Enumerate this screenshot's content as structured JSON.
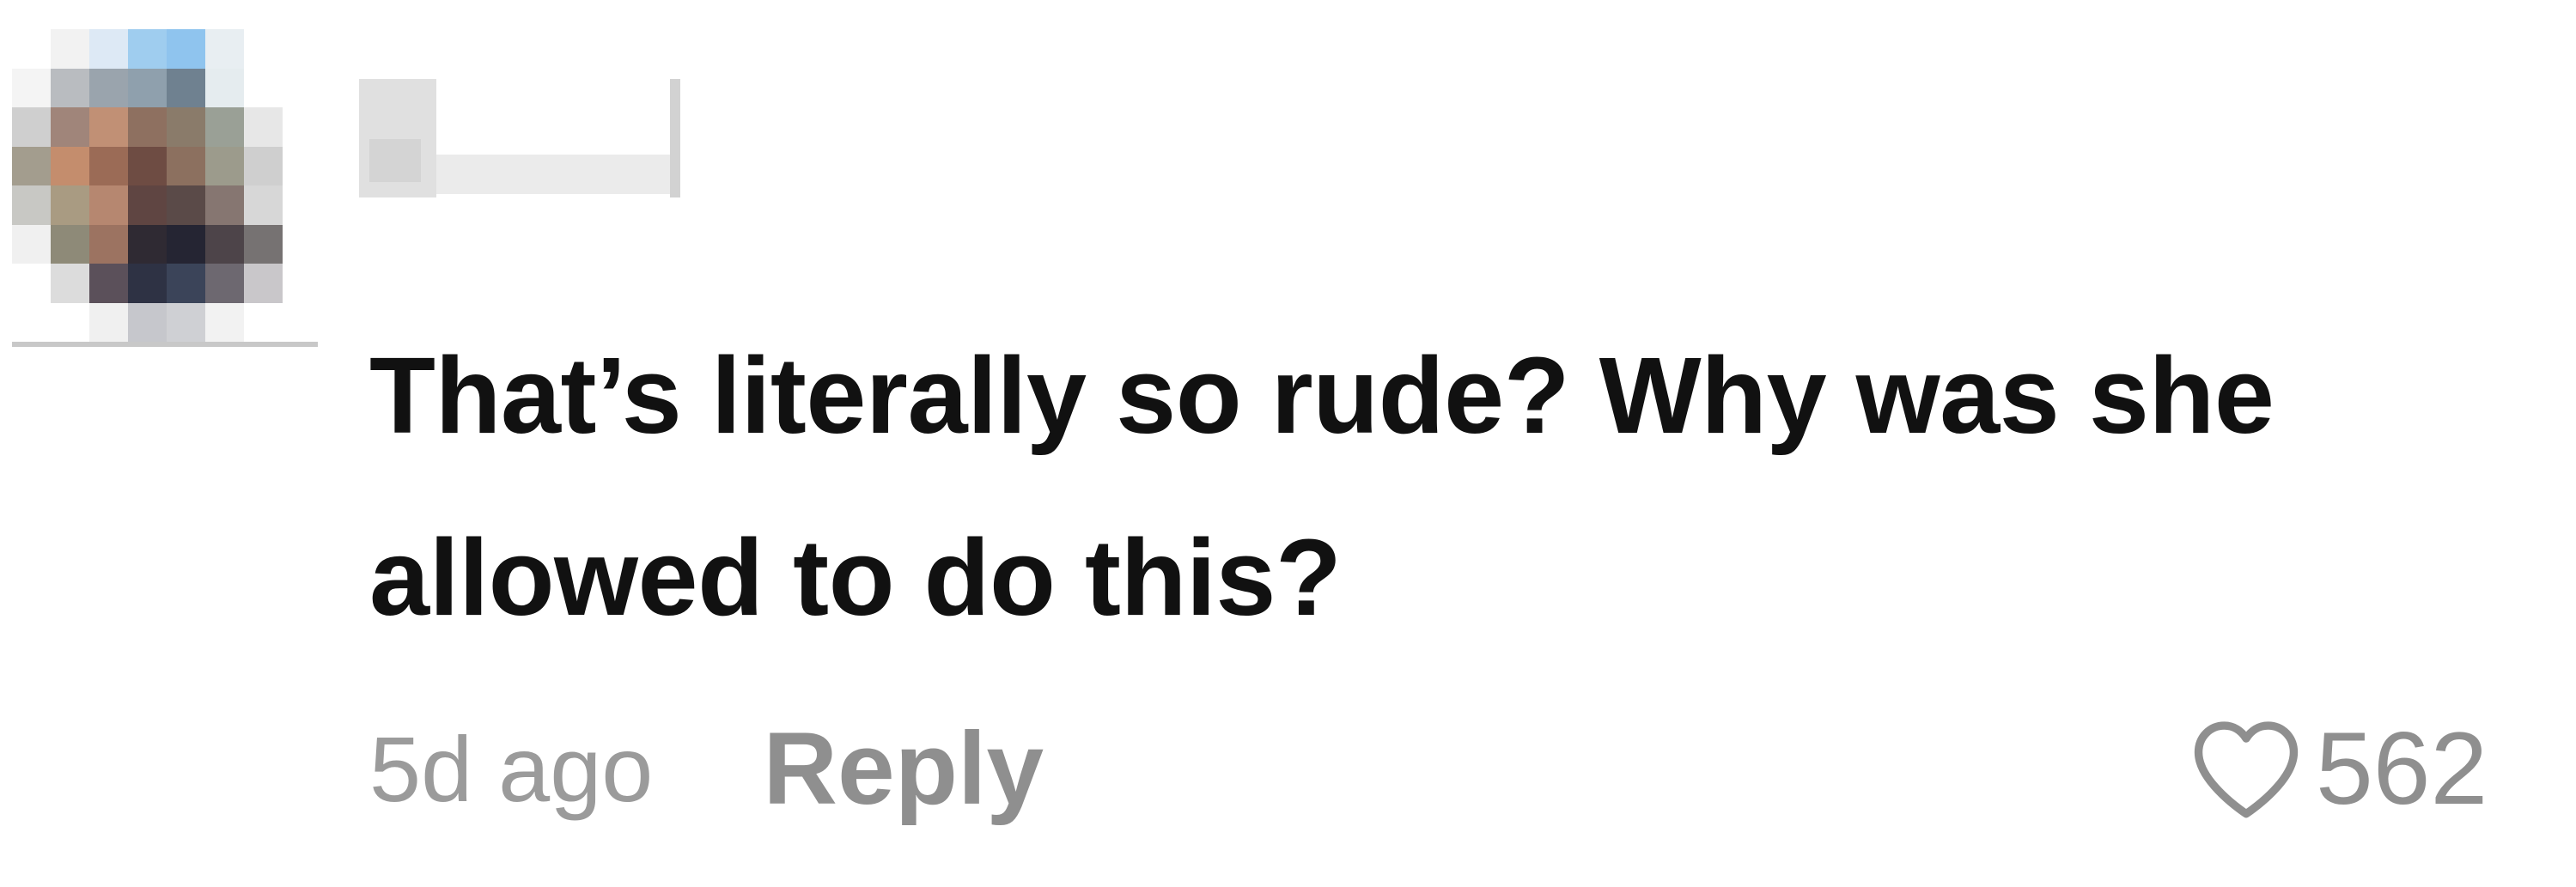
{
  "comment": {
    "text": "That’s literally so rude? Why was she allowed to do this?",
    "timestamp": "5d ago",
    "reply_label": "Reply",
    "like_count": "562"
  },
  "colors": {
    "text": "#111111",
    "meta": "#9b9b9b",
    "action": "#8f8f8f"
  },
  "icons": {
    "like": "heart-outline-icon"
  }
}
